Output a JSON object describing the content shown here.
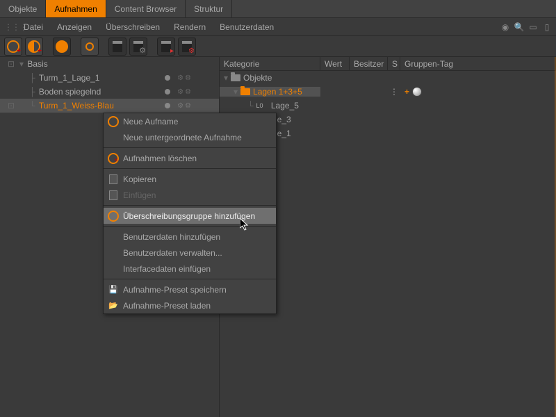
{
  "tabs": {
    "t0": "Objekte",
    "t1": "Aufnahmen",
    "t2": "Content Browser",
    "t3": "Struktur"
  },
  "menu": {
    "m0": "Datei",
    "m1": "Anzeigen",
    "m2": "Überschreiben",
    "m3": "Rendern",
    "m4": "Benutzerdaten"
  },
  "tree": {
    "root": "Basis",
    "n0": "Turm_1_Lage_1",
    "n1": "Boden spiegelnd",
    "n2": "Turm_1_Weiss-Blau"
  },
  "cols": {
    "kat": "Kategorie",
    "wert": "Wert",
    "bes": "Besitzer",
    "s": "S",
    "gt": "Gruppen-Tag"
  },
  "cat": {
    "c0": "Objekte",
    "c1": "Lagen 1+3+5",
    "c2": "Lage_5",
    "c3": "ge_3",
    "c4": "ge_1"
  },
  "ctx": {
    "i0": "Neue Aufname",
    "i1": "Neue untergeordnete Aufnahme",
    "i2": "Aufnahmen löschen",
    "i3": "Kopieren",
    "i4": "Einfügen",
    "i5": "Überschreibungsgruppe hinzufügen",
    "i6": "Benutzerdaten hinzufügen",
    "i7": "Benutzerdaten verwalten...",
    "i8": "Interfacedaten einfügen",
    "i9": "Aufnahme-Preset speichern",
    "i10": "Aufnahme-Preset laden"
  }
}
